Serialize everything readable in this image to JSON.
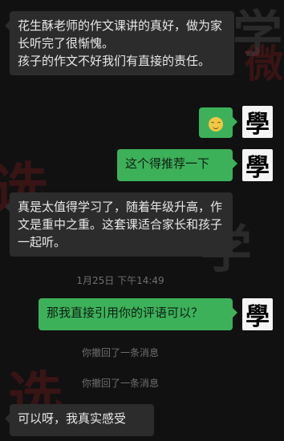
{
  "messages": {
    "m1": "花生酥老师的作文课讲的真好，做为家长听完了很惭愧。\n孩子的作文不好我们有直接的责任。",
    "m2_emoji_name": "smile-emoji-icon",
    "m3": "这个得推荐一下",
    "m4": "真是太值得学习了，随着年级升高，作文是重中之重。这套课适合家长和孩子一起听。",
    "timestamp": "1月25日 下午14:49",
    "m5": "那我直接引用你的评语可以？",
    "recall1": "你撤回了一条消息",
    "recall2": "你撤回了一条消息",
    "m6": "可以呀，我真实感受"
  },
  "avatar_char": "學",
  "colors": {
    "background": "#111111",
    "incoming_bubble": "#2c2c2c",
    "outgoing_bubble": "#3db15a"
  }
}
